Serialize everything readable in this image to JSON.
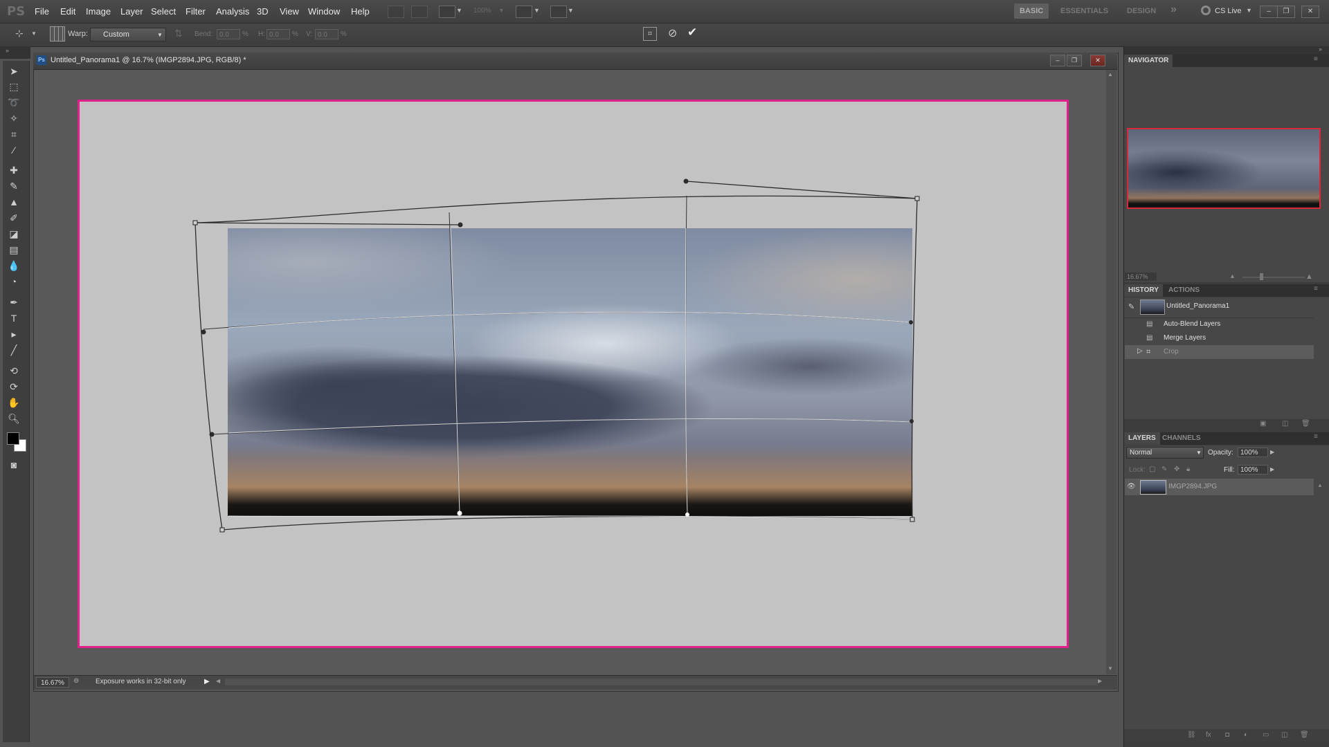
{
  "app": {
    "logo": "PS"
  },
  "menu": {
    "items": [
      "File",
      "Edit",
      "Image",
      "Layer",
      "Select",
      "Filter",
      "Analysis",
      "3D",
      "View",
      "Window",
      "Help"
    ]
  },
  "menubar_zoom": "100%",
  "workspaces": {
    "items": [
      "BASIC",
      "ESSENTIALS",
      "DESIGN"
    ],
    "active": "BASIC",
    "more": "»"
  },
  "cslive": {
    "label": "CS Live"
  },
  "options": {
    "warp_label": "Warp:",
    "warp_value": "Custom",
    "bend_label": "Bend:",
    "bend_value": "0.0",
    "bend_unit": "%",
    "h_label": "H:",
    "h_value": "0.0",
    "h_unit": "%",
    "v_label": "V:",
    "v_value": "0.0",
    "v_unit": "%"
  },
  "document": {
    "title": "Untitled_Panorama1 @ 16.7% (IMGP2894.JPG, RGB/8) *",
    "zoom": "16.67%",
    "status": "Exposure works in 32-bit only"
  },
  "navigator": {
    "tab": "NAVIGATOR",
    "zoom": "16.67%"
  },
  "history": {
    "tabs": [
      "HISTORY",
      "ACTIONS"
    ],
    "snapshot": "Untitled_Panorama1",
    "items": [
      "Auto-Blend Layers",
      "Merge Layers",
      "Crop"
    ],
    "selected": "Crop"
  },
  "layers": {
    "tabs": [
      "LAYERS",
      "CHANNELS"
    ],
    "blend_mode": "Normal",
    "opacity_label": "Opacity:",
    "opacity_value": "100%",
    "lock_label": "Lock:",
    "fill_label": "Fill:",
    "fill_value": "100%",
    "layer_name": "IMGP2894.JPG"
  },
  "colors": {
    "canvas_border": "#e0208a",
    "nav_frame": "#d9283a",
    "ui_bg": "#535353"
  }
}
